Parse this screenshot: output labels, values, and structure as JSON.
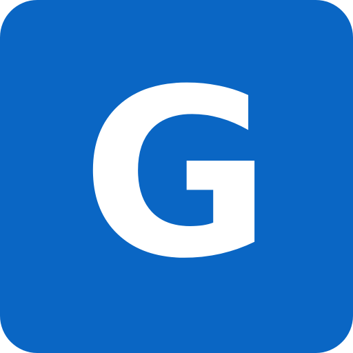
{
  "icon": {
    "letter": "G",
    "background_color": "#0a66c4",
    "letter_color": "#ffffff"
  }
}
